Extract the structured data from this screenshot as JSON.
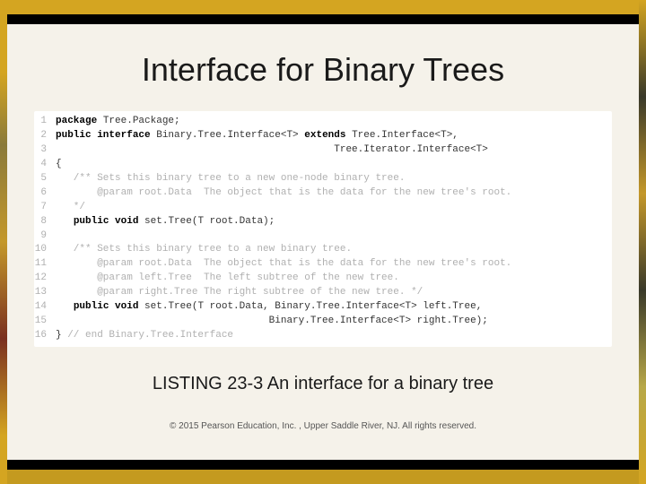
{
  "title": "Interface for Binary Trees",
  "caption": "LISTING 23-3 An interface for a binary tree",
  "copyright": "© 2015 Pearson Education, Inc. , Upper Saddle River, NJ.  All rights reserved.",
  "code": {
    "lines": [
      {
        "n": "1",
        "segments": [
          {
            "t": "package",
            "c": "kw"
          },
          {
            "t": " Tree.Package;",
            "c": ""
          }
        ]
      },
      {
        "n": "2",
        "segments": [
          {
            "t": "public interface",
            "c": "kw"
          },
          {
            "t": " Binary.Tree.Interface<T> ",
            "c": ""
          },
          {
            "t": "extends",
            "c": "kw"
          },
          {
            "t": " Tree.Interface<T>,",
            "c": ""
          }
        ]
      },
      {
        "n": "3",
        "segments": [
          {
            "t": "                                               Tree.Iterator.Interface<T>",
            "c": ""
          }
        ]
      },
      {
        "n": "4",
        "segments": [
          {
            "t": "{",
            "c": ""
          }
        ]
      },
      {
        "n": "5",
        "segments": [
          {
            "t": "   /** Sets this binary tree to a new one-node binary tree.",
            "c": "cm"
          }
        ]
      },
      {
        "n": "6",
        "segments": [
          {
            "t": "       @param root.Data  The object that is the data for the new tree's root.",
            "c": "cm"
          }
        ]
      },
      {
        "n": "7",
        "segments": [
          {
            "t": "   */",
            "c": "cm"
          }
        ]
      },
      {
        "n": "8",
        "segments": [
          {
            "t": "   ",
            "c": ""
          },
          {
            "t": "public void",
            "c": "kw"
          },
          {
            "t": " set.Tree(T root.Data);",
            "c": ""
          }
        ]
      },
      {
        "n": "9",
        "segments": [
          {
            "t": "",
            "c": ""
          }
        ]
      },
      {
        "n": "10",
        "segments": [
          {
            "t": "   /** Sets this binary tree to a new binary tree.",
            "c": "cm"
          }
        ]
      },
      {
        "n": "11",
        "segments": [
          {
            "t": "       @param root.Data  The object that is the data for the new tree's root.",
            "c": "cm"
          }
        ]
      },
      {
        "n": "12",
        "segments": [
          {
            "t": "       @param left.Tree  The left subtree of the new tree.",
            "c": "cm"
          }
        ]
      },
      {
        "n": "13",
        "segments": [
          {
            "t": "       @param right.Tree The right subtree of the new tree. */",
            "c": "cm"
          }
        ]
      },
      {
        "n": "14",
        "segments": [
          {
            "t": "   ",
            "c": ""
          },
          {
            "t": "public void",
            "c": "kw"
          },
          {
            "t": " set.Tree(T root.Data, Binary.Tree.Interface<T> left.Tree,",
            "c": ""
          }
        ]
      },
      {
        "n": "15",
        "segments": [
          {
            "t": "                                    Binary.Tree.Interface<T> right.Tree);",
            "c": ""
          }
        ]
      },
      {
        "n": "16",
        "segments": [
          {
            "t": "} ",
            "c": ""
          },
          {
            "t": "// end Binary.Tree.Interface",
            "c": "cm"
          }
        ]
      }
    ]
  }
}
